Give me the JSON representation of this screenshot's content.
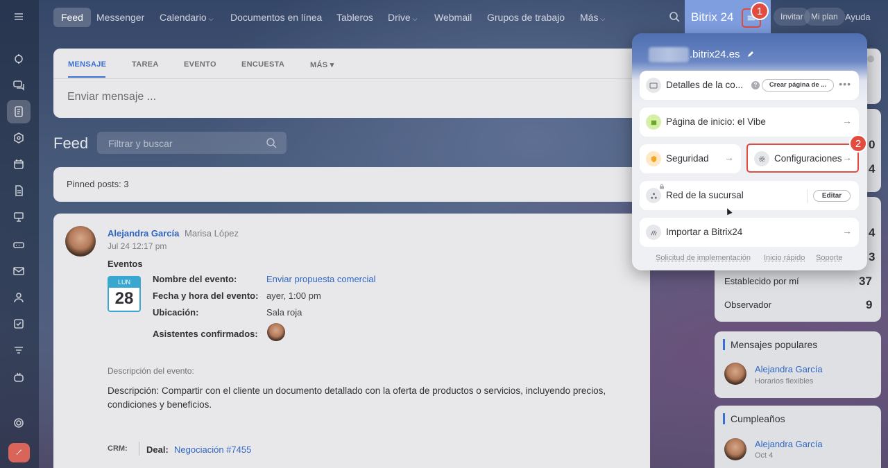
{
  "topnav": {
    "items": [
      "Feed",
      "Messenger",
      "Calendario",
      "Documentos en línea",
      "Tableros",
      "Drive",
      "Webmail",
      "Grupos de trabajo",
      "Más"
    ],
    "brand": "Bitrix 24",
    "invite": "Invitar",
    "plan": "Mi plan",
    "help": "Ayuda"
  },
  "composer": {
    "tabs": [
      "MENSAJE",
      "TAREA",
      "EVENTO",
      "ENCUESTA",
      "MÁS"
    ],
    "placeholder": "Enviar mensaje ..."
  },
  "feed": {
    "title": "Feed",
    "search_placeholder": "Filtrar y buscar",
    "pinned": "Pinned posts: 3"
  },
  "post": {
    "author": "Alejandra García",
    "recipient": "Marisa López",
    "date": "Jul 24 12:17 pm",
    "section": "Eventos",
    "cal_day": "LUN",
    "cal_num": "28",
    "labels": [
      "Nombre del evento:",
      "Fecha y hora del evento:",
      "Ubicación:",
      "Asistentes confirmados:"
    ],
    "event_name": "Enviar propuesta comercial",
    "event_time": "ayer, 1:00 pm",
    "event_location": "Sala roja",
    "desc_heading": "Descripción del evento:",
    "description": "Descripción: Compartir con el cliente un documento detallado con la oferta de productos o servicios, incluyendo precios, condiciones y beneficios.",
    "crm_label": "CRM:",
    "deal_label": "Deal:",
    "deal_link": "Negociación #7455"
  },
  "right": {
    "partial_nums": [
      "0",
      "4",
      "4",
      "3"
    ],
    "rows": [
      {
        "label": "Establecido por mí",
        "value": "37"
      },
      {
        "label": "Observador",
        "value": "9"
      }
    ],
    "popular": {
      "title": "Mensajes populares",
      "person": "Alejandra García",
      "sub": "Horarios flexibles"
    },
    "birthdays": {
      "title": "Cumpleaños",
      "person": "Alejandra García",
      "sub": "Oct 4"
    }
  },
  "popup": {
    "domain": ".bitrix24.es",
    "details": "Detalles de la co...",
    "create_page": "Crear página de ...",
    "home": "Página de inicio: el Vibe",
    "security": "Seguridad",
    "settings": "Configuraciones",
    "branch": "Red de la sucursal",
    "edit": "Editar",
    "import": "Importar a Bitrix24",
    "footer": [
      "Solicitud de implementación",
      "Inicio rápido",
      "Soporte"
    ]
  },
  "badges": [
    "1",
    "2"
  ],
  "colors": {
    "accent": "#3a6fd0",
    "highlight": "#e24b3f",
    "brand_tab": "#7f9ee0"
  }
}
